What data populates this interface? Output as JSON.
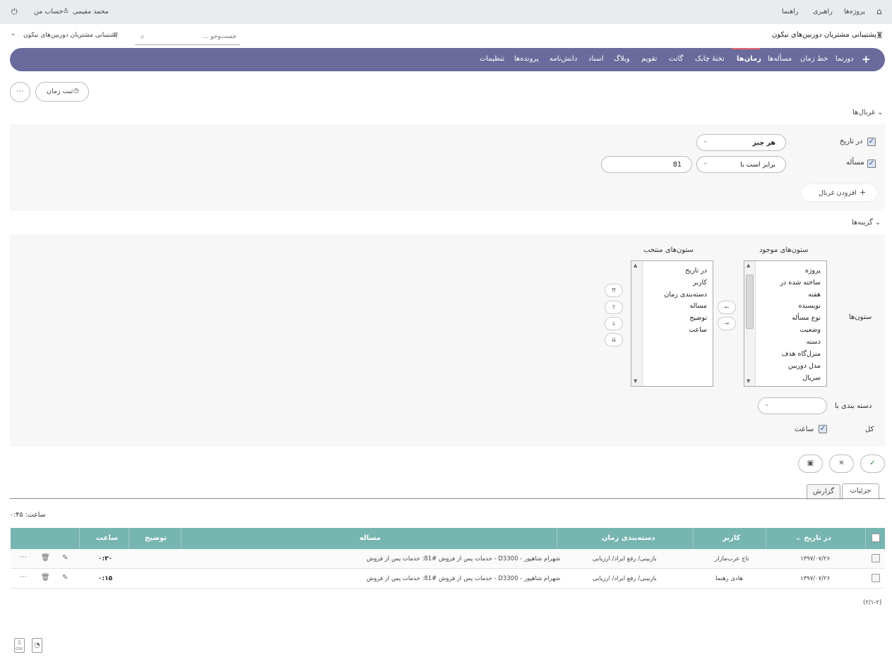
{
  "topbar": {
    "home_icon": "home-icon",
    "projects": "پروژه‌ها",
    "admin": "راهبری",
    "help": "راهنما",
    "user_name": "محمد مقیمی",
    "my_account": "حساب من"
  },
  "header": {
    "project_title": "پشتیبانی مشتریان دوربین‌های نیکون",
    "search_placeholder": "جست‌وجو ...",
    "project_jump": "پشتیبانی مشتریان دوربین‌های نیکون"
  },
  "nav": {
    "items": [
      "دورنما",
      "خط زمان",
      "مسأله‌ها",
      "زمان‌ها",
      "تختهٔ چابک",
      "گانت",
      "تقویم",
      "وبلاگ",
      "اسناد",
      "دانش‌نامه",
      "پرونده‌ها",
      "تنظیمات"
    ],
    "active": "زمان‌ها"
  },
  "actions": {
    "log_time": "ثبت زمان"
  },
  "filters": {
    "title": "غربال‌ها",
    "date_label": "در تاریخ",
    "date_value": "هر چیز",
    "issue_label": "مسأله",
    "issue_operator": "برابر است با",
    "issue_value": "81",
    "add_filter": "افزودن غربال"
  },
  "options": {
    "title": "گزینه‌ها",
    "columns_label": "ستون‌ها",
    "available_title": "ستون‌های موجود",
    "selected_title": "ستون‌های منتخب",
    "available": [
      "پروژه",
      "ساخته شده در",
      "هفته",
      "نویسنده",
      "نوع مسأله",
      "وضعیت",
      "دسته",
      "منزل‌گاه هدف",
      "مدل دوربین",
      "سریال"
    ],
    "selected": [
      "در تاریخ",
      "کاربر",
      "دسته‌بندی زمان",
      "مساله",
      "توضیح",
      "ساعت"
    ],
    "group_by_label": "دسته بندی با",
    "totals_label": "کل",
    "totals_hours": "ساعت"
  },
  "tabs": {
    "details": "جزئیات",
    "report": "گزارش"
  },
  "summary": {
    "hours_total": "ساعت: ۰:۴۵"
  },
  "table": {
    "headers": {
      "date": "در تاریخ",
      "user": "کاربر",
      "activity": "دسته‌بندی زمان",
      "issue": "مساله",
      "comment": "توضیح",
      "hours": "ساعت"
    },
    "rows": [
      {
        "date": "۱۳۹۷/۰۷/۲۶",
        "user": "تاج عرب‌مازار",
        "activity": "بازبینی/ رفع ایراد/ ارزیابی",
        "issue": "خدمات پس از فروش #81: خدمات پس از فروش - D3300 - شهرام شاهپور",
        "comment": "",
        "hours": "۰:۳۰"
      },
      {
        "date": "۱۳۹۷/۰۷/۲۶",
        "user": "هادی رهنما",
        "activity": "بازبینی/ رفع ایراد/ ارزیابی",
        "issue": "خدمات پس از فروش #81: خدمات پس از فروش - D3300 - شهرام شاهپور",
        "comment": "",
        "hours": "۰:۱۵"
      }
    ]
  },
  "pagination": "(۲/۱-۲)",
  "export": {
    "csv": "CSV"
  },
  "colors": {
    "nav_bg": "#6b6a9c",
    "table_header": "#76b5b0",
    "accent_active": "#e06666",
    "ok_green": "#2e7d32"
  }
}
